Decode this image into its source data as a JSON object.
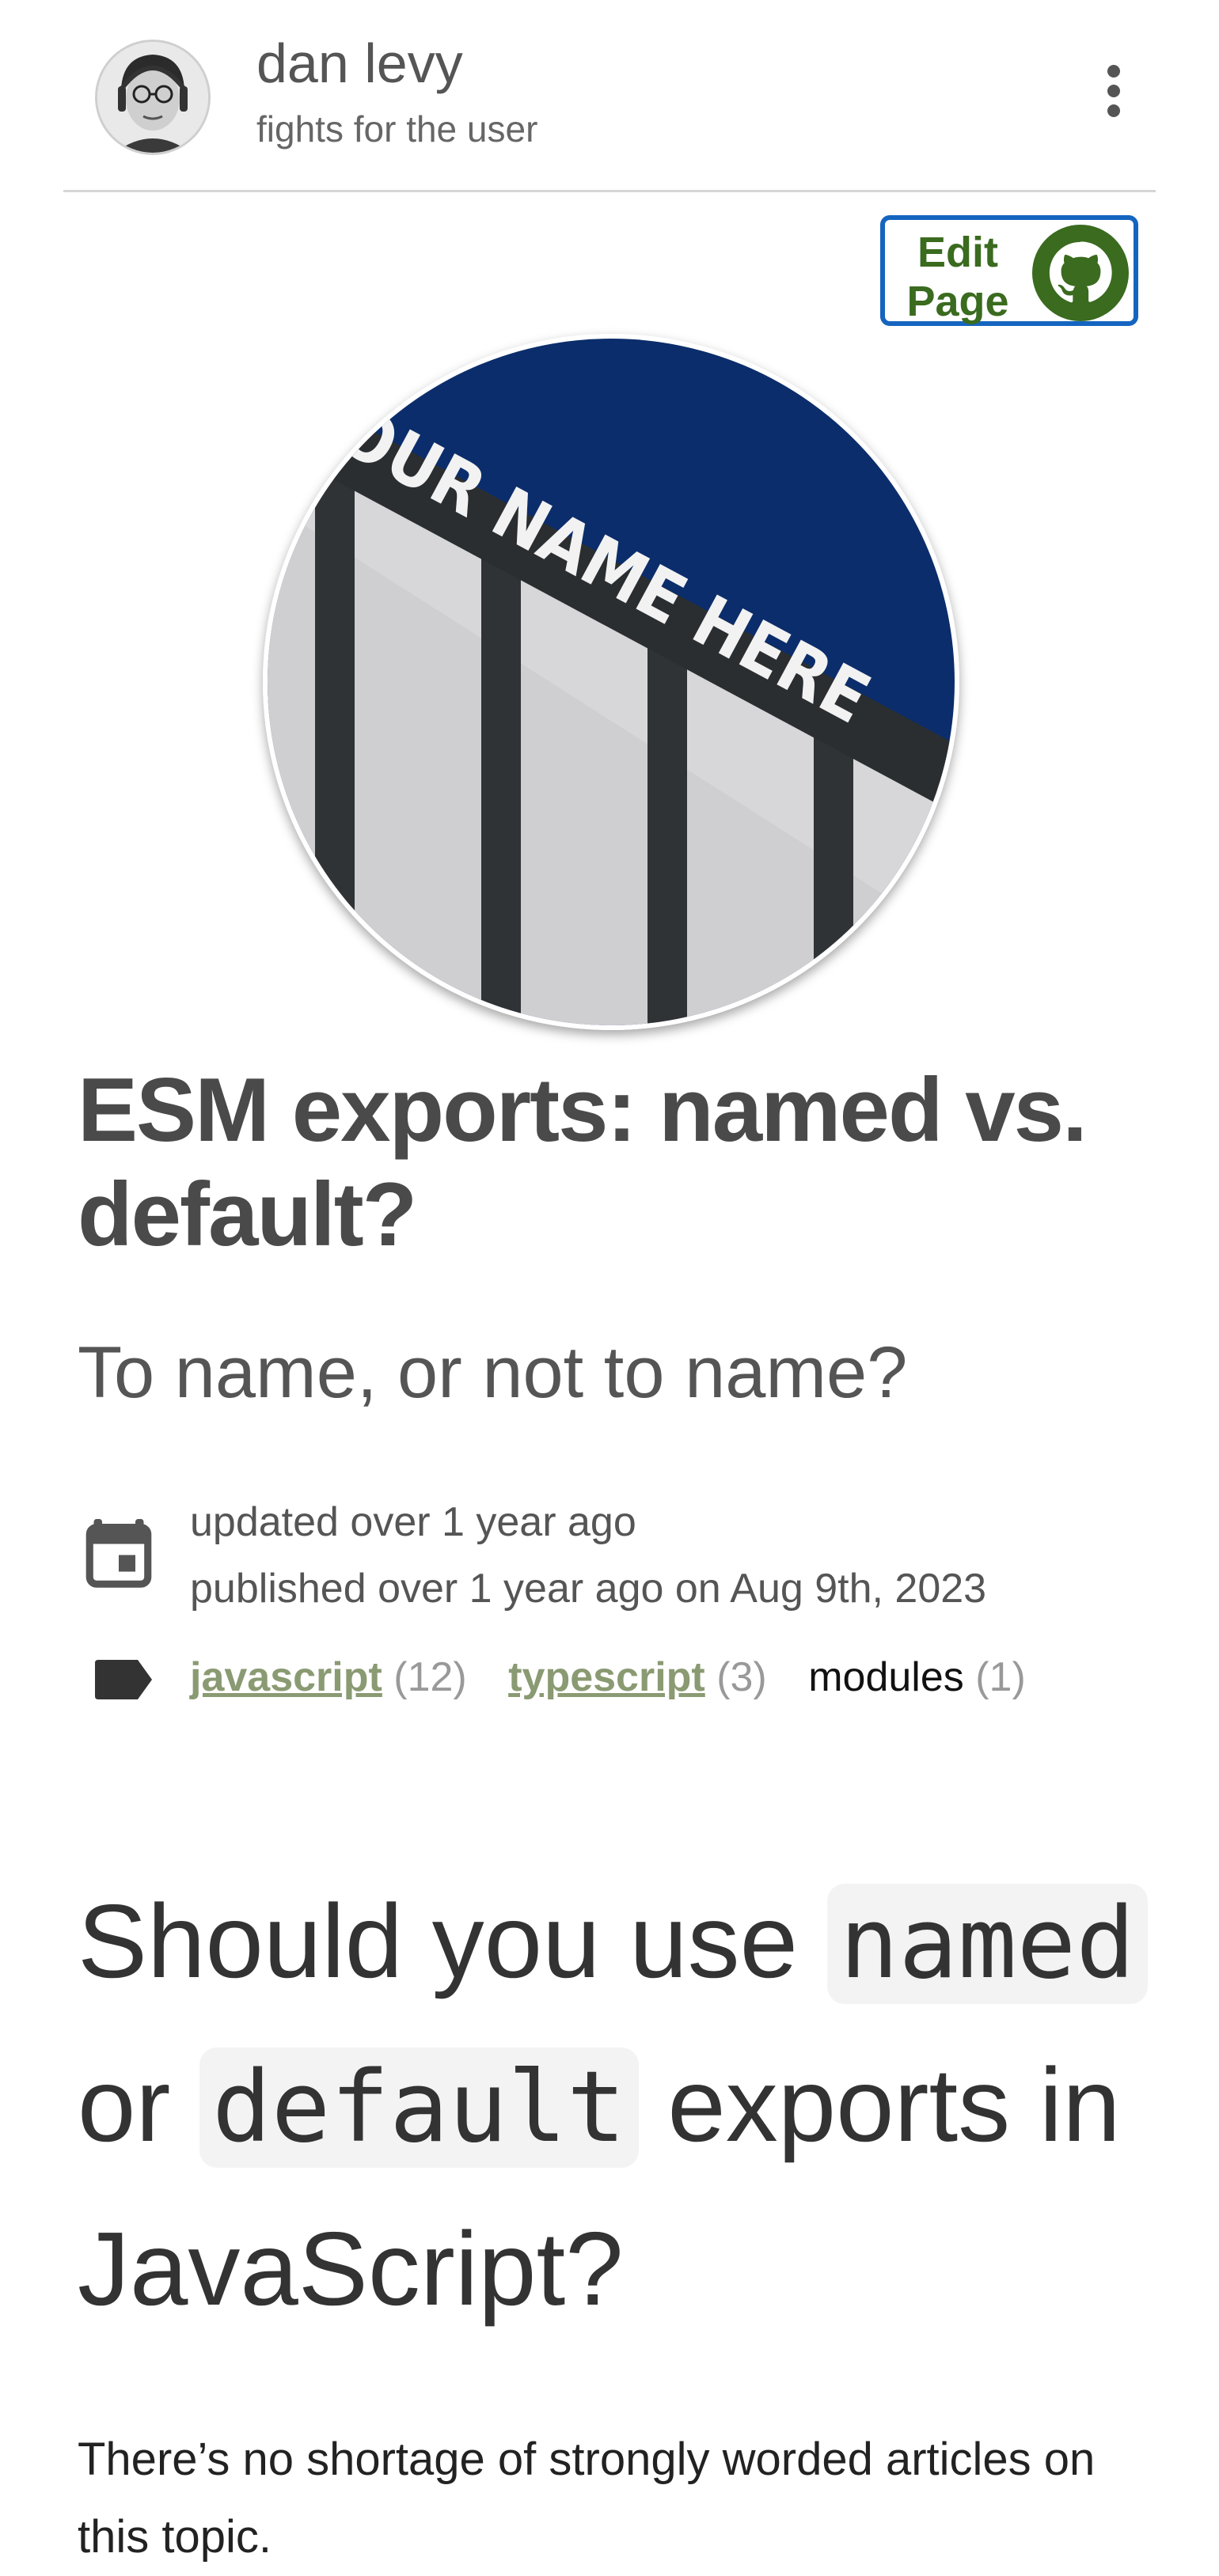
{
  "header": {
    "site_name": "dan levy",
    "tagline": "fights for the user",
    "menu_icon": "vertical-dots-icon"
  },
  "edit_button": {
    "label": "Edit Page",
    "icon": "github-icon",
    "border_color": "#1565c0",
    "text_color": "#3a6b1f"
  },
  "hero": {
    "image_text": "YOUR NAME HERE"
  },
  "article": {
    "title": "ESM exports: named vs. default?",
    "subtitle": "To name, or not to name?",
    "updated": "updated over 1 year ago",
    "published": "published over 1 year ago on Aug 9th, 2023",
    "tags": [
      {
        "name": "javascript",
        "count": "(12)",
        "link": true
      },
      {
        "name": "typescript",
        "count": "(3)",
        "link": true
      },
      {
        "name": "modules",
        "count": "(1)",
        "link": false
      }
    ],
    "tag_link_color": "#8a9a72"
  },
  "content": {
    "headline_pre": "Should you use ",
    "headline_code1": "named",
    "headline_mid": "or ",
    "headline_code2": "default",
    "headline_post": " exports in JavaScript?",
    "paragraph": "There’s no shortage of strongly worded articles on this topic."
  }
}
